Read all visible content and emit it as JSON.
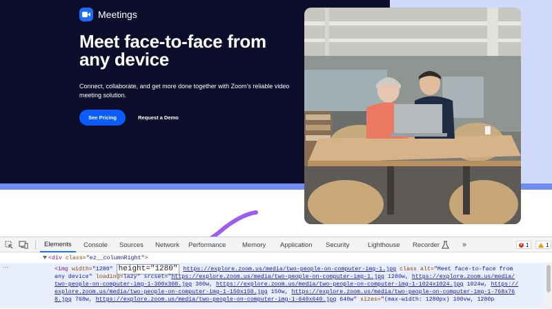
{
  "hero": {
    "logo_text": "Meetings",
    "headline": "Meet face-to-face from any device",
    "subtext": "Connect, collaborate, and get more done together with Zoom's reliable video meeting solution.",
    "primary_button": "See Pricing",
    "secondary_link": "Request a Demo",
    "colors": {
      "background": "#0b0d2a",
      "accent_blue": "#0b5cff",
      "light_panel": "#cfd9f9",
      "bar": "#6f8df4"
    }
  },
  "annotation": {
    "arrow_color": "#9b5cf0",
    "arrow_icon": "curved-arrow-icon"
  },
  "devtools": {
    "tabs": [
      "Elements",
      "Console",
      "Sources",
      "Network",
      "Performance",
      "Memory",
      "Application",
      "Security",
      "Lighthouse",
      "Recorder"
    ],
    "active_tab": "Elements",
    "more_tabs_icon": "»",
    "errors_count": "1",
    "warnings_count": "1",
    "code": {
      "line1_tag_open": "<div",
      "line1_attr": " class=",
      "line1_val": "\"ez__columnRight\"",
      "line1_close": ">",
      "img_open": "<img",
      "width_attr": " width=",
      "width_val": "\"1280\"",
      "height_highlight": "height=\"1280\"",
      "src_url": "https://explore.zoom.us/media/two-people-on-computer-img-1.jpg",
      "class_attr": "class",
      "alt_attr": "alt=",
      "alt_val_part1": "\"Meet face-to-face from",
      "alt_val_part2": "any device\"",
      "loading_attr": "loading=",
      "srcset_attr": "lazy\" srcset=\"",
      "srcset_1": "https://explore.zoom.us/media/two-people-on-computer-img-1.jpg",
      "srcset_1_w": " 1280w, ",
      "srcset_2a": "https://explore.zoom.us/media/",
      "srcset_2b": "two-people-on-computer-img-1-300x300.jpg",
      "srcset_2_w": " 300w, ",
      "srcset_3": "https://explore.zoom.us/media/two-people-on-computer-img-1-1024x1024.jpg",
      "srcset_3_w": " 1024w, ",
      "srcset_4a": "https://",
      "srcset_4b": "explore.zoom.us/media/two-people-on-computer-img-1-150x150.jpg",
      "srcset_4_w": " 150w, ",
      "srcset_5": "https://explore.zoom.us/media/two-people-on-computer-img-1-768x76",
      "srcset_5b": "8.jpg",
      "srcset_5_w": " 768w, ",
      "srcset_6": "https://explore.zoom.us/media/two-people-on-computer-img-1-640x640.jpg",
      "srcset_6_w": " 640w\" ",
      "sizes_attr": "sizes=",
      "sizes_val": "\"(max-width: 1280px) 100vw, 1280p"
    }
  }
}
